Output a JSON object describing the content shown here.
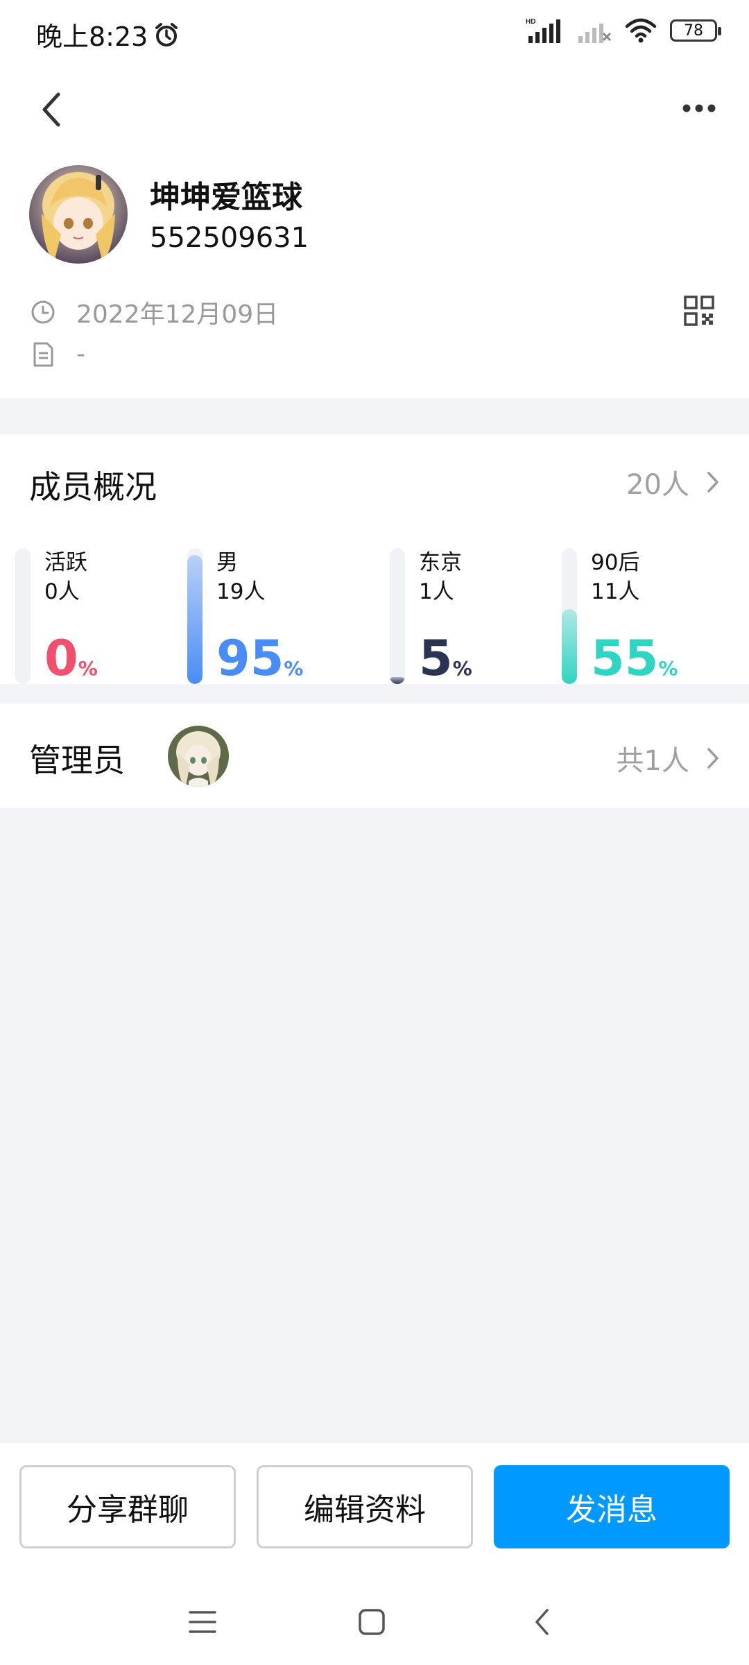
{
  "status_bar": {
    "time": "晚上8:23",
    "battery": "78",
    "icons": [
      "alarm-icon",
      "hd-signal-icon",
      "signal-icon",
      "wifi-icon",
      "battery-icon"
    ]
  },
  "header": {
    "back_icon": "chevron-left-icon",
    "more_icon": "more-dots-icon"
  },
  "group": {
    "name": "坤坤爱篮球",
    "id": "552509631",
    "created_date": "2022年12月09日",
    "description": "-"
  },
  "members": {
    "title": "成员概况",
    "count": "20人",
    "stats": [
      {
        "label": "活跃",
        "count": "0人",
        "percent": "0",
        "value": 0,
        "color": "#f0506e"
      },
      {
        "label": "男",
        "count": "19人",
        "percent": "95",
        "value": 95,
        "color": "#4a8cf5"
      },
      {
        "label": "东京",
        "count": "1人",
        "percent": "5",
        "value": 5,
        "color": "#2a3352"
      },
      {
        "label": "90后",
        "count": "11人",
        "percent": "55",
        "value": 55,
        "color": "#2fd4c2"
      }
    ],
    "percent_sign": "%"
  },
  "admins": {
    "title": "管理员",
    "count": "共1人"
  },
  "actions": {
    "share": "分享群聊",
    "edit": "编辑资料",
    "message": "发消息"
  },
  "colors": {
    "primary": "#0099ff",
    "background": "#f3f4f8"
  }
}
